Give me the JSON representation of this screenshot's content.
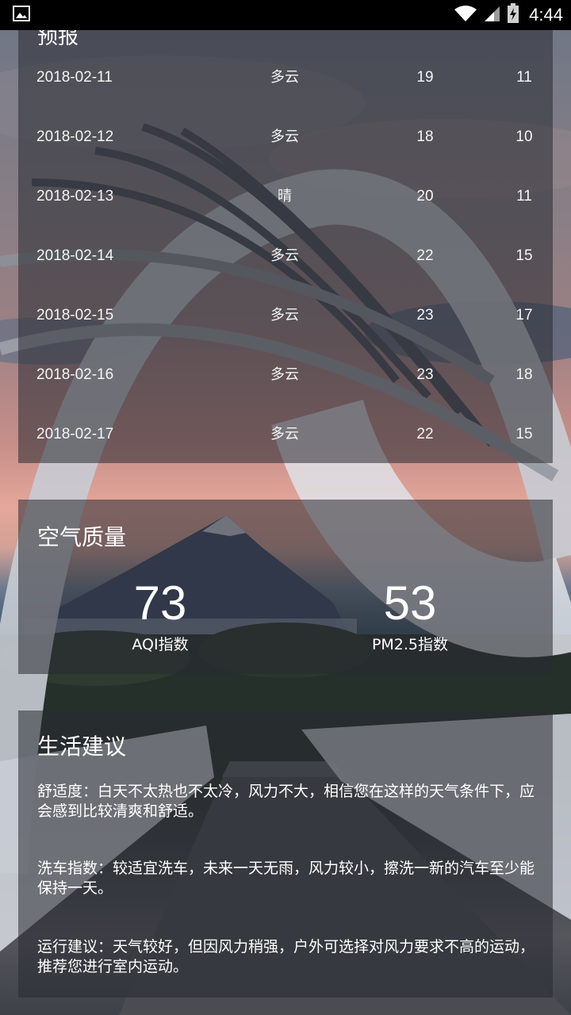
{
  "status_bar": {
    "time": "4:44",
    "icons": [
      "image-icon",
      "wifi-icon",
      "signal-icon",
      "battery-icon"
    ]
  },
  "forecast": {
    "title": "预报",
    "rows": [
      {
        "date": "2018-02-11",
        "condition": "多云",
        "max": "19",
        "min": "11"
      },
      {
        "date": "2018-02-12",
        "condition": "多云",
        "max": "18",
        "min": "10"
      },
      {
        "date": "2018-02-13",
        "condition": "晴",
        "max": "20",
        "min": "11"
      },
      {
        "date": "2018-02-14",
        "condition": "多云",
        "max": "22",
        "min": "15"
      },
      {
        "date": "2018-02-15",
        "condition": "多云",
        "max": "23",
        "min": "17"
      },
      {
        "date": "2018-02-16",
        "condition": "多云",
        "max": "23",
        "min": "18"
      },
      {
        "date": "2018-02-17",
        "condition": "多云",
        "max": "22",
        "min": "15"
      }
    ]
  },
  "aqi": {
    "title": "空气质量",
    "aqi_value": "73",
    "aqi_label": "AQI指数",
    "pm25_value": "53",
    "pm25_label": "PM2.5指数"
  },
  "suggestion": {
    "title": "生活建议",
    "comfort": "舒适度：白天不太热也不太冷，风力不大，相信您在这样的天气条件下，应会感到比较清爽和舒适。",
    "car_wash": "洗车指数：较适宜洗车，未来一天无雨，风力较小，擦洗一新的汽车至少能保持一天。",
    "sport": "运行建议：天气较好，但因风力稍强，户外可选择对风力要求不高的运动，推荐您进行室内运动。"
  }
}
